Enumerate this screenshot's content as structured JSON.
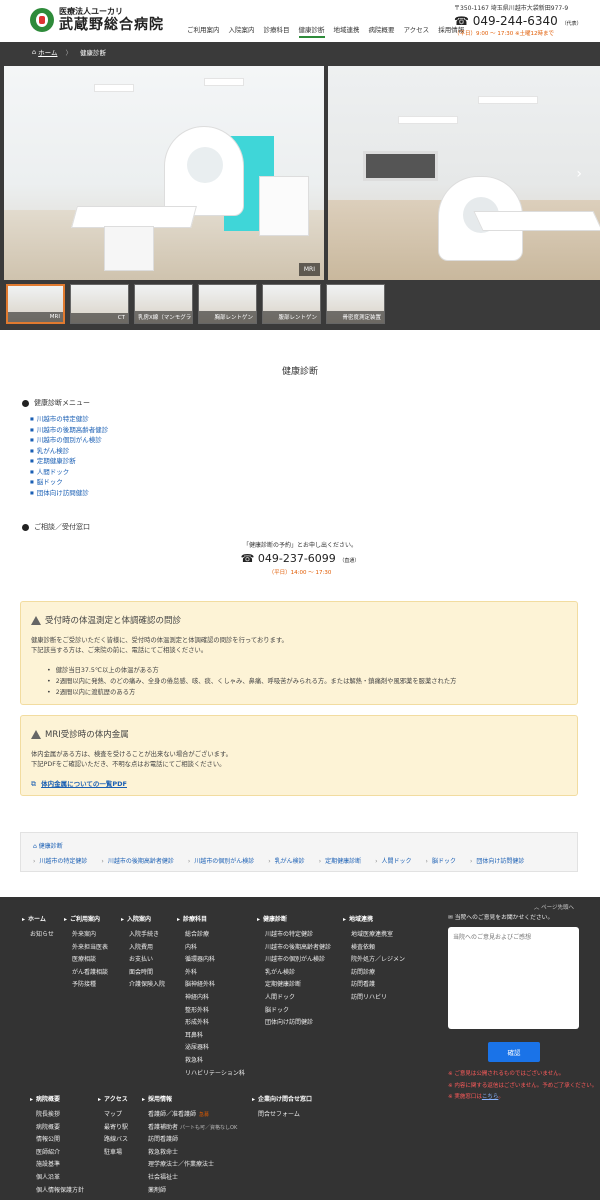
{
  "header": {
    "logo_sub": "医療法人ユーカリ",
    "logo_main": "武蔵野総合病院",
    "nav": [
      "ご利用案内",
      "入院案内",
      "診療科目",
      "健康診断",
      "地域連携",
      "病院概要",
      "アクセス",
      "採用情報"
    ],
    "address": "〒350-1167 埼玉県川越市大袋新田977-9",
    "tel": "049-244-6340",
    "tel_note": "（代表）",
    "hours": "（平日）9:00 〜 17:30 ※土曜12時まで"
  },
  "breadcrumb": {
    "home": "ホーム",
    "current": "健康診断"
  },
  "gallery": {
    "caption": "MRI",
    "thumbs": [
      "MRI",
      "CT",
      "乳房X線（マンモグラフィ）",
      "胸部レントゲン",
      "腹部レントゲン",
      "骨密度測定装置"
    ]
  },
  "main": {
    "title": "健康診断",
    "menu_head": "健康診断メニュー",
    "menu_items": [
      "川越市の特定健診",
      "川越市の後期高齢者健診",
      "川越市の個別がん検診",
      "乳がん検診",
      "定期健康診断",
      "人間ドック",
      "脳ドック",
      "団体向け訪問健診"
    ],
    "consult_head": "ご相談／受付窓口",
    "consult_note": "「健康診断の予約」とお申し出ください。",
    "consult_tel": "049-237-6099",
    "consult_tel_note": "（直通）",
    "consult_hours": "（平日）14:00 〜 17:30"
  },
  "notice1": {
    "title": "受付時の体温測定と体調確認の問診",
    "p1": "健康診断をご受診いただく皆様に、受付時の体温測定と体調確認の問診を行っております。",
    "p2": "下記該当する方は、ご来院の前に、電話にてご相談ください。",
    "items": [
      "健診当日37.5℃以上の体温がある方",
      "2週間以内に発熱、のどの痛み、全身の倦怠感、咳、痰、くしゃみ、鼻痛、呼吸苦がみられる方。または解熱・鎮痛剤や風邪薬を服薬された方",
      "2週間以内に渡航歴のある方"
    ]
  },
  "notice2": {
    "title": "MRI受診時の体内金属",
    "p1": "体内金属がある方は、検査を受けることが出来ない場合がございます。",
    "p2": "下記PDFをご確認いただき、不明な点はお電話にてご相談ください。",
    "link": "体内金属についての一覧PDF"
  },
  "bottom_nav": {
    "top": "健康診断",
    "items": [
      "川越市の特定健診",
      "川越市の後期高齢者健診",
      "川越市の個別がん検診",
      "乳がん検診",
      "定期健康診断",
      "人間ドック",
      "脳ドック",
      "団体向け訪問健診"
    ]
  },
  "footer": {
    "pagetop": "ページ先頭へ",
    "col1": {
      "head": "ホーム",
      "items": [
        "お知らせ"
      ]
    },
    "col2": {
      "head": "ご利用案内",
      "items": [
        "外来案内",
        "外来担当医表",
        "医療相談",
        "がん看護相談",
        "予防接種"
      ]
    },
    "col3": {
      "head": "入院案内",
      "items": [
        "入院手続き",
        "入院費用",
        "お支払い",
        "面会時間",
        "介護保険入院"
      ]
    },
    "col4": {
      "head": "診療科目",
      "items": [
        "総合診療",
        "内科",
        "循環器内科",
        "外科",
        "脳神経外科",
        "神経内科",
        "整形外科",
        "形成外科",
        "耳鼻科",
        "泌尿器科",
        "救急科",
        "リハビリテーション科"
      ]
    },
    "col5": {
      "head": "健康診断",
      "items": [
        "川越市の特定健診",
        "川越市の後期高齢者健診",
        "川越市の個別がん検診",
        "乳がん検診",
        "定期健康診断",
        "人間ドック",
        "脳ドック",
        "団体向け訪問健診"
      ]
    },
    "col6": {
      "head": "地域連携",
      "items": [
        "地域医療連携室",
        "検査依頼",
        "院外処方／レジメン",
        "訪問診療",
        "訪問看護",
        "訪問リハビリ"
      ]
    },
    "col7": {
      "head": "病院概要",
      "items": [
        "院長挨拶",
        "病院概要",
        "情報公開",
        "医師紹介",
        "施設基準",
        "個人沿革",
        "個人情報保護方針"
      ]
    },
    "col8": {
      "head": "アクセス",
      "items": [
        "マップ",
        "最寄り駅",
        "路線バス",
        "駐車場"
      ]
    },
    "col9": {
      "head": "採用情報",
      "items": [
        "看護師／准看護師",
        "看護補助者",
        "訪問看護師",
        "救急救命士",
        "理学療法士／作業療法士",
        "社会福祉士",
        "薬剤師"
      ],
      "tag": "急募",
      "small": "パートも可／資格なしOK"
    },
    "col10": {
      "head": "企業向け問合せ窓口",
      "items": [
        "問合せフォーム"
      ]
    },
    "form": {
      "label": "当院へのご意見をお聞かせください。",
      "placeholder": "当院へのご意見およびご感想",
      "button": "確認",
      "note1": "※ ご意見は公開されるものではございません。",
      "note2": "※ 内容に関する返信はございません。予めご了承ください。",
      "note3_pre": "※ 実施窓口は",
      "note3_link": "こちら",
      "note3_post": "。"
    }
  }
}
